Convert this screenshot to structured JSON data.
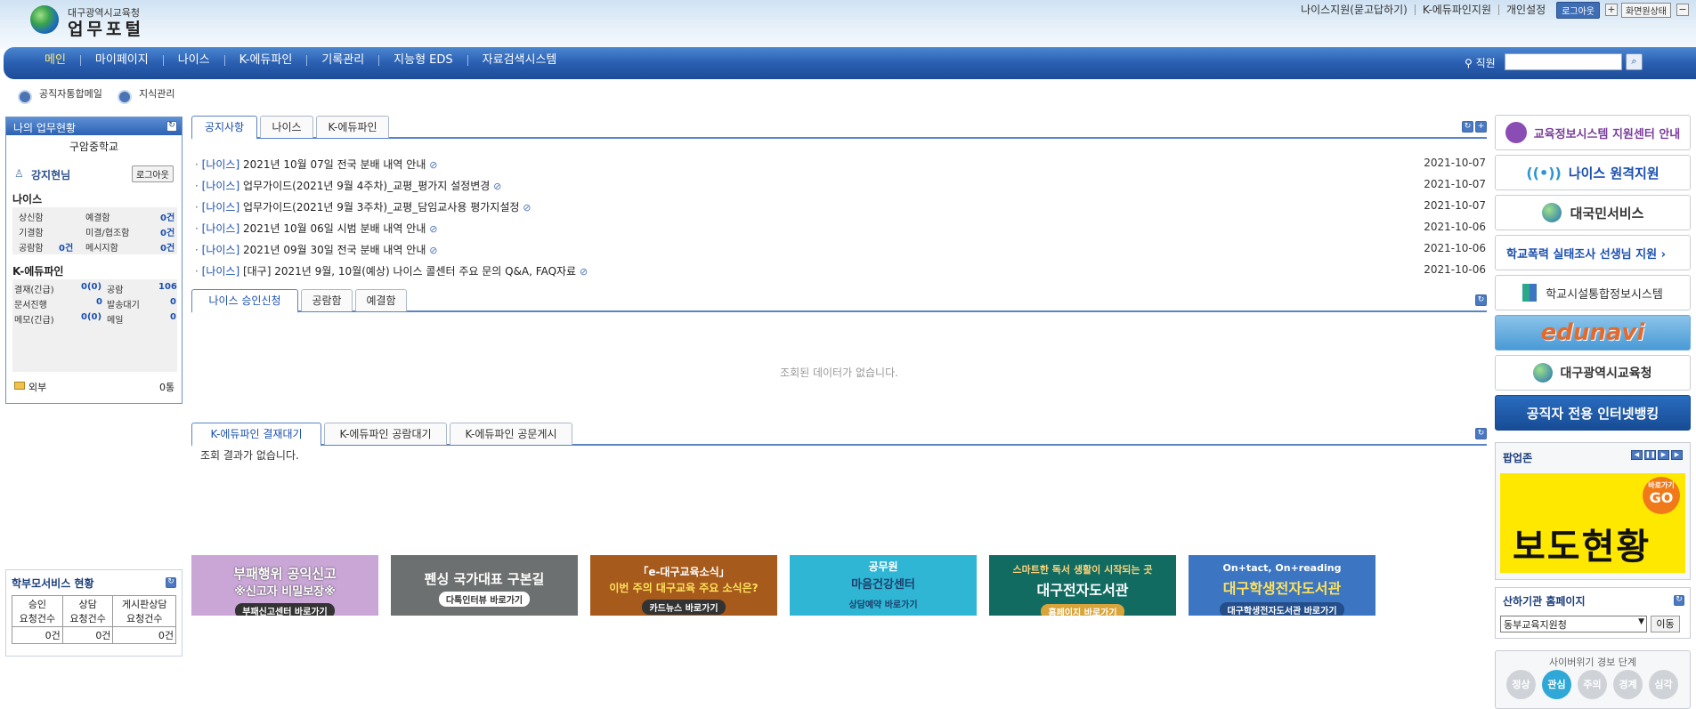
{
  "header": {
    "org": "대구광역시교육청",
    "title": "업무포털",
    "links": [
      "나이스지원(묻고답하기)",
      "K-에듀파인지원",
      "개인설정"
    ],
    "logout": "로그아웃",
    "restore": "화면원상태"
  },
  "nav": {
    "items": [
      "메인",
      "마이페이지",
      "나이스",
      "K-에듀파인",
      "기록관리",
      "지능형 EDS",
      "자료검색시스템"
    ],
    "search_label": "직원",
    "search_placeholder": ""
  },
  "quick": {
    "mail": "공직자통합메일",
    "knowledge": "지식관리"
  },
  "my_work": {
    "title": "나의 업무현황",
    "school": "구암중학교",
    "user": "강지현님",
    "logout": "로그아웃",
    "neis": {
      "label": "나이스",
      "rows": [
        [
          "상신함",
          "",
          "예결함",
          "0건"
        ],
        [
          "기결함",
          "",
          "미결/협조함",
          "0건"
        ],
        [
          "공람함",
          "0건",
          "메시지함",
          "0건"
        ]
      ]
    },
    "edufine": {
      "label": "K-에듀파인",
      "rows": [
        [
          "결재(긴급)",
          "0(0)",
          "공람",
          "106"
        ],
        [
          "문서진행",
          "0",
          "발송대기",
          "0"
        ],
        [
          "메모(긴급)",
          "0(0)",
          "메일",
          "0"
        ]
      ]
    },
    "external_mail": "외부",
    "external_count": "0통"
  },
  "parents": {
    "title": "학부모서비스 현황",
    "headers": [
      "승인\n요청건수",
      "상담\n요청건수",
      "게시판상담\n요청건수"
    ],
    "values": [
      "0건",
      "0건",
      "0건"
    ]
  },
  "notice_tabs": [
    "공지사항",
    "나이스",
    "K-에듀파인"
  ],
  "notices": [
    {
      "cat": "[나이스]",
      "title": "2021년 10월 07일 전국 분배 내역 안내",
      "date": "2021-10-07"
    },
    {
      "cat": "[나이스]",
      "title": "업무가이드(2021년 9월 4주차)_교평_평가지 설정변경",
      "date": "2021-10-07"
    },
    {
      "cat": "[나이스]",
      "title": "업무가이드(2021년 9월 3주차)_교평_담임교사용 평가지설정",
      "date": "2021-10-07"
    },
    {
      "cat": "[나이스]",
      "title": "2021년 10월 06일 시범 분배 내역 안내",
      "date": "2021-10-06"
    },
    {
      "cat": "[나이스]",
      "title": "2021년 09월 30일 전국 분배 내역 안내",
      "date": "2021-10-06"
    },
    {
      "cat": "[나이스]",
      "title": "[대구] 2021년 9월, 10월(예상) 나이스 콜센터 주요 문의 Q&A, FAQ자료",
      "date": "2021-10-06"
    }
  ],
  "approval_tabs": [
    "나이스 승인신청",
    "공람함",
    "예결함"
  ],
  "approval_empty": "조회된 데이터가 없습니다.",
  "edufine_tabs": [
    "K-에듀파인 결재대기",
    "K-에듀파인 공람대기",
    "K-에듀파인 공문게시"
  ],
  "edufine_empty": "조회 결과가 없습니다.",
  "banners": [
    {
      "line1": "부패행위 공익신고",
      "line2": "※신고자 비밀보장※",
      "btn": "부패신고센터 바로가기",
      "color": "#c9a6d6"
    },
    {
      "line1": "펜싱 국가대표 구본길",
      "line2": "",
      "btn": "다톡인터뷰 바로가기",
      "color": "#6d7070"
    },
    {
      "line1": "「e-대구교육소식」",
      "line2": "이번 주의 대구교육 주요 소식은?",
      "btn": "카드뉴스 바로가기",
      "color": "#a65a1c"
    },
    {
      "line1": "공무원",
      "line2": "마음건강센터",
      "btn": "상담예약 바로가기",
      "color": "#2fb6d4"
    },
    {
      "line1": "스마트한 독서 생활이 시작되는 곳",
      "line2": "대구전자도서관",
      "btn": "홈페이지 바로가기",
      "color": "#116b61"
    },
    {
      "line1": "On+tact, On+reading",
      "line2": "대구학생전자도서관",
      "btn": "대구학생전자도서관 바로가기",
      "color": "#3c76c2"
    }
  ],
  "right_links": [
    {
      "text": "교육정보시스템 지원센터 안내",
      "color": "#7a3d9c"
    },
    {
      "text": "나이스 원격지원",
      "color": "#1b4fb0"
    },
    {
      "text": "대국민서비스",
      "color": "#333333"
    },
    {
      "text": "학교폭력 실태조사 선생님 지원 ›",
      "color": "#1b4fb0"
    },
    {
      "text": "학교시설통합정보시스템",
      "color": "#333333"
    },
    {
      "text": "edunavi",
      "color": "#e36a2c"
    },
    {
      "text": "대구광역시교육청",
      "color": "#222222"
    },
    {
      "text": "공직자 전용 인터넷뱅킹",
      "color": "#ffffff"
    }
  ],
  "popup": {
    "title": "팝업존",
    "text": "보도현황",
    "go_small": "바로가기",
    "go": "GO"
  },
  "sub_sites": {
    "title": "산하기관 홈페이지",
    "selected": "동부교육지원청",
    "go": "이동"
  },
  "cyber": {
    "title": "사이버위기 경보 단계",
    "levels": [
      "정상",
      "관심",
      "주의",
      "경계",
      "심각"
    ],
    "active": "관심"
  }
}
